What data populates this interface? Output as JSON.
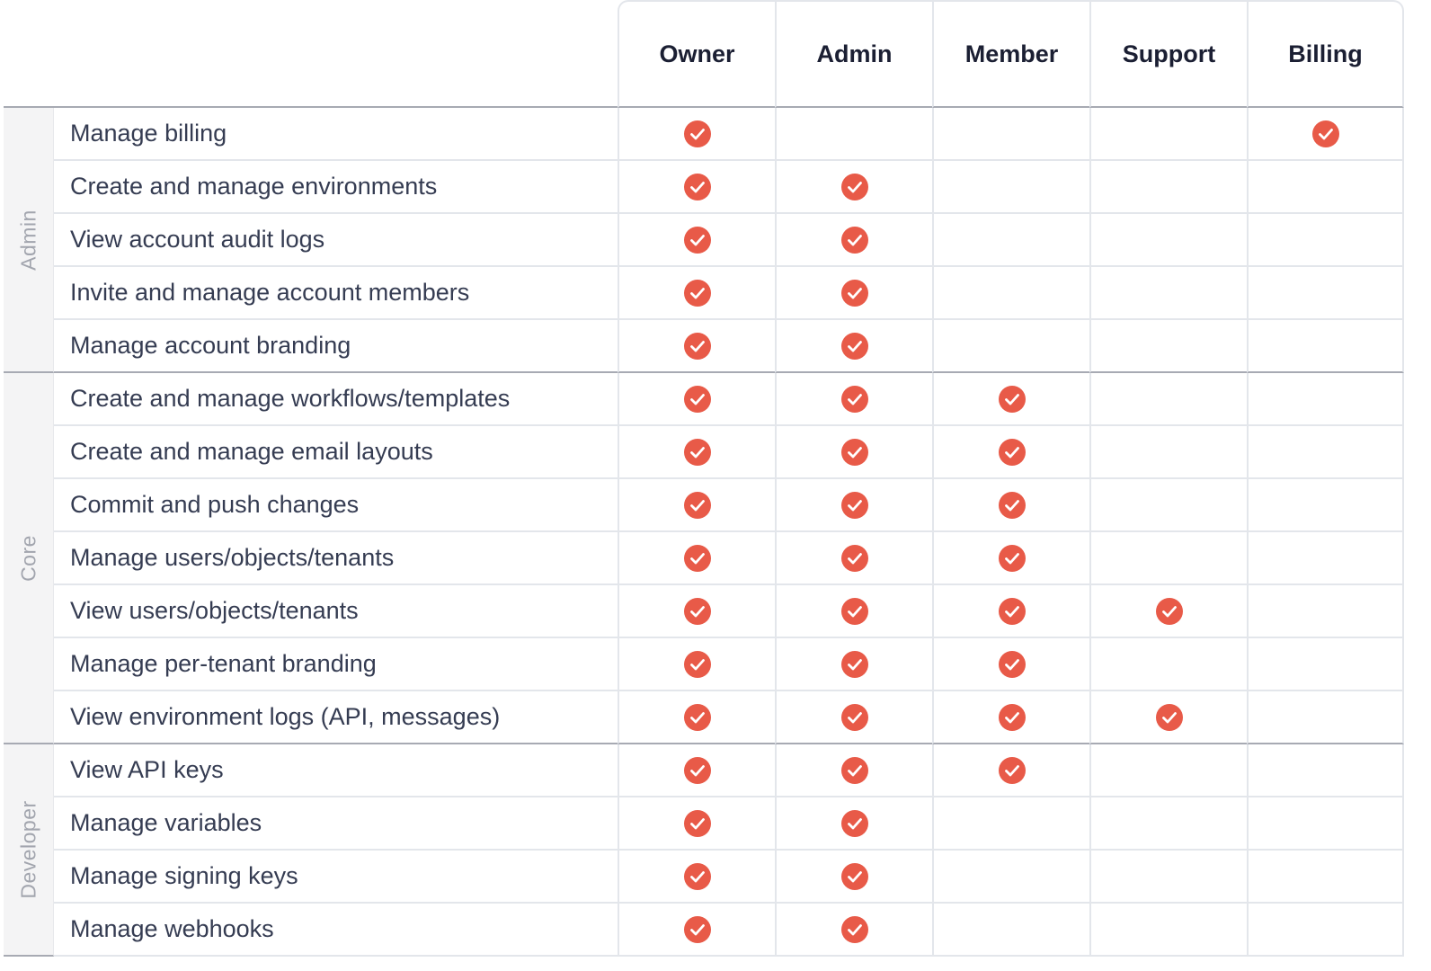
{
  "colors": {
    "check": "#e85a48",
    "check_mark": "#ffffff",
    "header_text": "#1b1f33",
    "label_text": "#353c52",
    "group_text": "#a2a5ae"
  },
  "roles": [
    "Owner",
    "Admin",
    "Member",
    "Support",
    "Billing"
  ],
  "groups": [
    {
      "name": "Admin",
      "permissions": [
        {
          "label": "Manage billing",
          "roles": [
            true,
            false,
            false,
            false,
            true
          ]
        },
        {
          "label": "Create and manage environments",
          "roles": [
            true,
            true,
            false,
            false,
            false
          ]
        },
        {
          "label": "View account audit logs",
          "roles": [
            true,
            true,
            false,
            false,
            false
          ]
        },
        {
          "label": "Invite and manage account members",
          "roles": [
            true,
            true,
            false,
            false,
            false
          ]
        },
        {
          "label": "Manage account branding",
          "roles": [
            true,
            true,
            false,
            false,
            false
          ]
        }
      ]
    },
    {
      "name": "Core",
      "permissions": [
        {
          "label": "Create and manage workflows/templates",
          "roles": [
            true,
            true,
            true,
            false,
            false
          ]
        },
        {
          "label": "Create and manage email layouts",
          "roles": [
            true,
            true,
            true,
            false,
            false
          ]
        },
        {
          "label": "Commit and push changes",
          "roles": [
            true,
            true,
            true,
            false,
            false
          ]
        },
        {
          "label": "Manage users/objects/tenants",
          "roles": [
            true,
            true,
            true,
            false,
            false
          ]
        },
        {
          "label": "View users/objects/tenants",
          "roles": [
            true,
            true,
            true,
            true,
            false
          ]
        },
        {
          "label": "Manage per-tenant branding",
          "roles": [
            true,
            true,
            true,
            false,
            false
          ]
        },
        {
          "label": "View environment logs (API, messages)",
          "roles": [
            true,
            true,
            true,
            true,
            false
          ]
        }
      ]
    },
    {
      "name": "Developer",
      "permissions": [
        {
          "label": "View API keys",
          "roles": [
            true,
            true,
            true,
            false,
            false
          ]
        },
        {
          "label": "Manage variables",
          "roles": [
            true,
            true,
            false,
            false,
            false
          ]
        },
        {
          "label": "Manage signing keys",
          "roles": [
            true,
            true,
            false,
            false,
            false
          ]
        },
        {
          "label": "Manage webhooks",
          "roles": [
            true,
            true,
            false,
            false,
            false
          ]
        }
      ]
    }
  ],
  "icons": {
    "granted": "check-circle-icon"
  }
}
